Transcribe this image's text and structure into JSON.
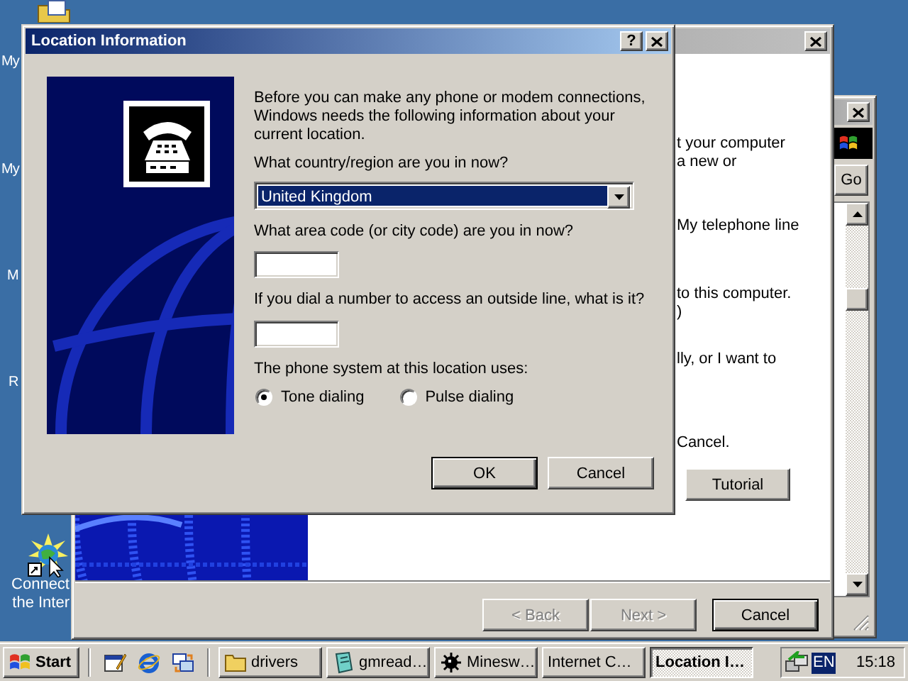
{
  "desktop": {
    "icon_labels": [
      "My",
      "My",
      "M",
      "R"
    ],
    "shortcut": {
      "lines": [
        "Connect",
        "the Inter"
      ]
    }
  },
  "back_window": {
    "active": false,
    "go_button": "Go"
  },
  "wizard": {
    "active": false,
    "paragraphs": [
      [
        "t your computer",
        "a new or"
      ],
      [
        "My telephone line"
      ],
      [
        "to this computer.",
        ")"
      ],
      [
        "lly, or I want to"
      ],
      [
        "Cancel."
      ]
    ],
    "tutorial_button": "Tutorial",
    "buttons": [
      {
        "label": "< Back",
        "disabled": true,
        "default": false
      },
      {
        "label": "Next >",
        "disabled": true,
        "default": false
      },
      {
        "label": "Cancel",
        "disabled": false,
        "default": true
      }
    ]
  },
  "dialog": {
    "title": "Location Information",
    "active": true,
    "help_button": "?",
    "intro": "Before you can make any phone or modem connections, Windows needs the following information about your current location.",
    "country": {
      "label": "What country/region are you in now?",
      "value": "United Kingdom",
      "focused": true
    },
    "area_code": {
      "label": "What area code (or city code) are you in now?"
    },
    "outside_line": {
      "label": "If you dial a number to access an outside line, what is it?"
    },
    "phone_system": {
      "label": "The phone system at this location uses:",
      "options": [
        {
          "label": "Tone dialing",
          "selected": true
        },
        {
          "label": "Pulse dialing",
          "selected": false
        }
      ]
    },
    "buttons": [
      {
        "label": "OK",
        "default": true
      },
      {
        "label": "Cancel",
        "default": false
      }
    ]
  },
  "taskbar": {
    "start": "Start",
    "tasks": [
      {
        "label": "drivers",
        "kind": "folder",
        "selected": false
      },
      {
        "label": "gmread…",
        "kind": "document",
        "selected": false
      },
      {
        "label": "Minesw…",
        "kind": "mine",
        "selected": false
      },
      {
        "label": "Internet C…",
        "selected": false
      },
      {
        "label": "Location I…",
        "selected": true
      }
    ],
    "tray": {
      "language": "EN",
      "clock": "15:18"
    }
  }
}
